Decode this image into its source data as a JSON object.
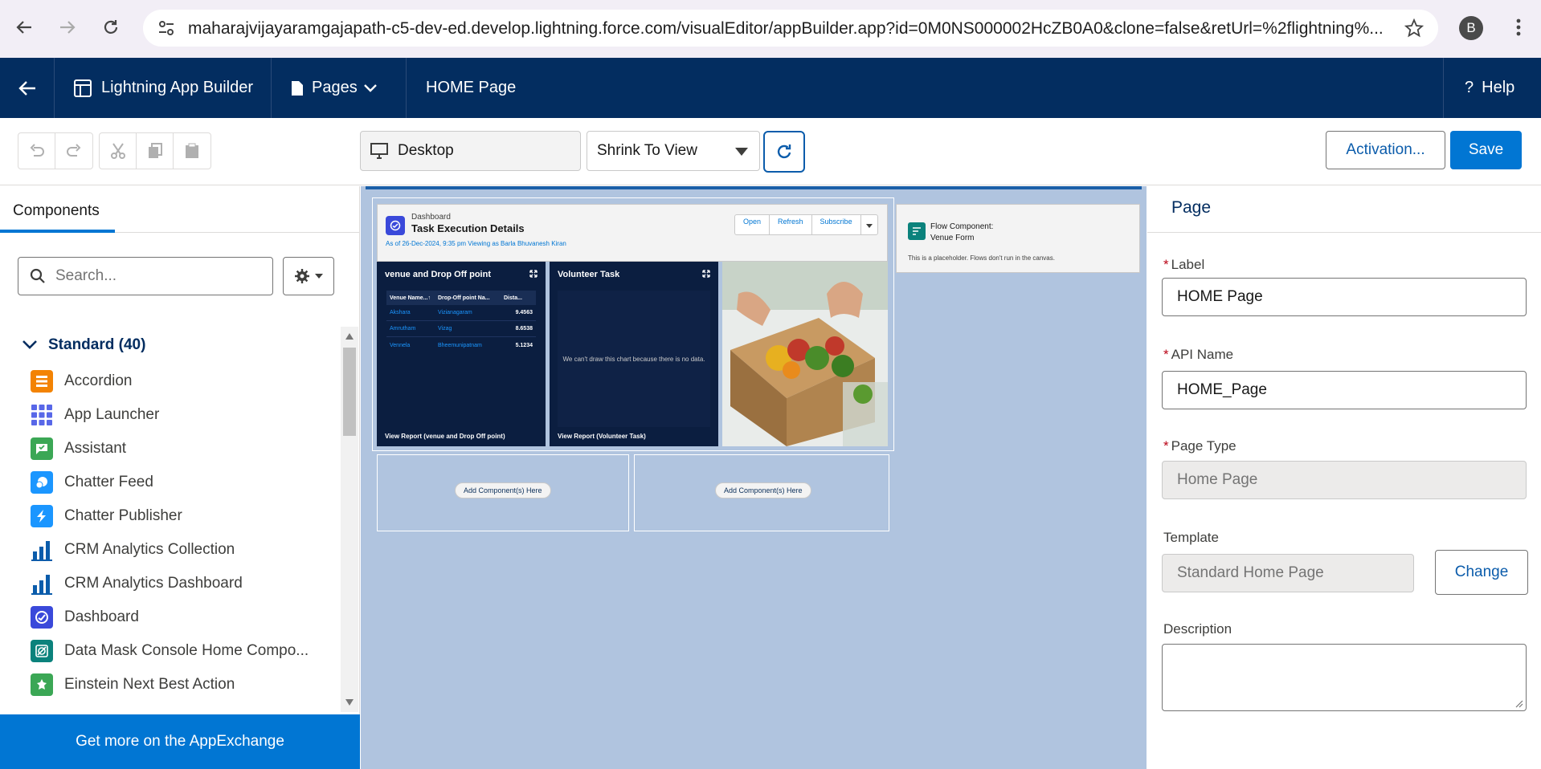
{
  "browser": {
    "url": "maharajvijayaramgajapath-c5-dev-ed.develop.lightning.force.com/visualEditor/appBuilder.app?id=0M0NS000002HcZB0A0&clone=false&retUrl=%2flightning%...",
    "avatar_letter": "B"
  },
  "header": {
    "app_name": "Lightning App Builder",
    "pages_label": "Pages",
    "page_title": "HOME Page",
    "help_label": "Help"
  },
  "toolbar": {
    "device": "Desktop",
    "zoom": "Shrink To View",
    "activation_label": "Activation...",
    "save_label": "Save"
  },
  "left_panel": {
    "tab_label": "Components",
    "search_placeholder": "Search...",
    "group_label": "Standard (40)",
    "items": [
      {
        "label": "Accordion",
        "icon": "accordion-icon",
        "color": "#f38303"
      },
      {
        "label": "App Launcher",
        "icon": "app-launcher-icon",
        "color": "#5867e8"
      },
      {
        "label": "Assistant",
        "icon": "assistant-icon",
        "color": "#3ba755"
      },
      {
        "label": "Chatter Feed",
        "icon": "chatter-feed-icon",
        "color": "#1b96ff"
      },
      {
        "label": "Chatter Publisher",
        "icon": "chatter-publisher-icon",
        "color": "#1b96ff"
      },
      {
        "label": "CRM Analytics Collection",
        "icon": "analytics-icon",
        "color": "#0b5cab"
      },
      {
        "label": "CRM Analytics Dashboard",
        "icon": "analytics-icon",
        "color": "#0b5cab"
      },
      {
        "label": "Dashboard",
        "icon": "dashboard-icon",
        "color": "#3a49da"
      },
      {
        "label": "Data Mask Console Home Compo...",
        "icon": "data-mask-icon",
        "color": "#0b827c"
      },
      {
        "label": "Einstein Next Best Action",
        "icon": "einstein-icon",
        "color": "#3ba755"
      }
    ],
    "appexchange_label": "Get more on the AppExchange"
  },
  "canvas": {
    "dashboard": {
      "type_label": "Dashboard",
      "title": "Task Execution Details",
      "subtitle": "As of 26-Dec-2024, 9:35 pm Viewing as Barla Bhuvanesh Kiran",
      "buttons": [
        "Open",
        "Refresh",
        "Subscribe"
      ]
    },
    "card1": {
      "title": "venue and Drop Off point",
      "columns": [
        "Venue Name...↑",
        "Drop-Off point Na...",
        "Dista..."
      ],
      "rows": [
        [
          "Akshara",
          "Vizianagaram",
          "9.4563"
        ],
        [
          "Amrutham",
          "Vizag",
          "8.6538"
        ],
        [
          "Vennela",
          "Bheemunipatnam",
          "5.1234"
        ]
      ],
      "footer": "View Report (venue and Drop Off point)"
    },
    "card2": {
      "title": "Volunteer Task",
      "nodata": "We can't draw this chart because there is no data.",
      "footer": "View Report (Volunteer Task)"
    },
    "add_here": "Add Component(s) Here",
    "flow": {
      "line1": "Flow Component:",
      "line2": "Venue Form",
      "note": "This is a placeholder. Flows don't run in the canvas."
    }
  },
  "right_panel": {
    "title": "Page",
    "label_label": "Label",
    "label_value": "HOME Page",
    "api_label": "API Name",
    "api_value": "HOME_Page",
    "pagetype_label": "Page Type",
    "pagetype_value": "Home Page",
    "template_label": "Template",
    "template_value": "Standard Home Page",
    "change_label": "Change",
    "description_label": "Description"
  }
}
